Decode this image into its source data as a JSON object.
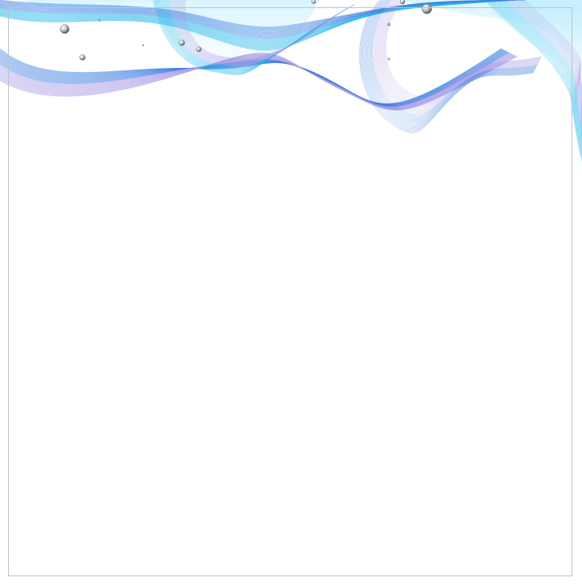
{
  "background_color": "#ffffff",
  "frame_border_color": "#b9c4cc",
  "wave_palette": {
    "cyan": "#1fb6ec",
    "blue": "#3d7fe0",
    "light_cyan": "#bfeefc",
    "lavender": "#a99ce6"
  },
  "bubble_color": "#5a5f66"
}
